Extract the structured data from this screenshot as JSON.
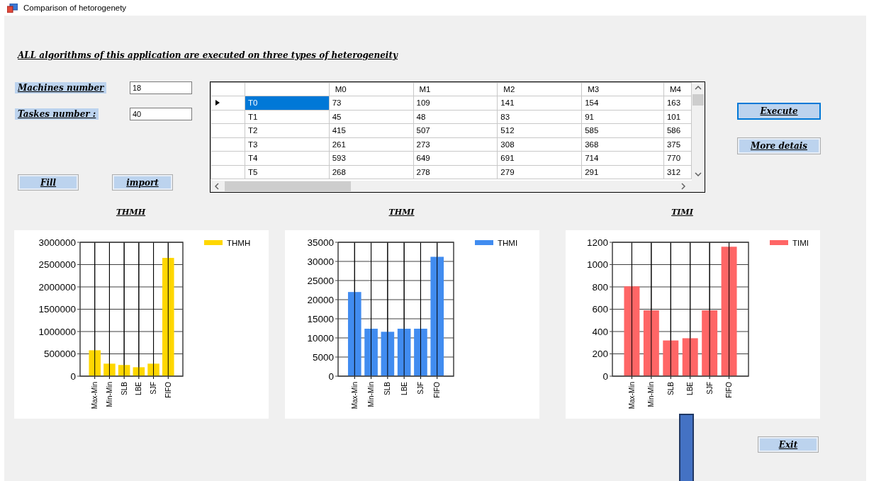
{
  "window": {
    "title": "Comparison of hetorogenety"
  },
  "heading": "ALL algorithms of this application are executed on three types of heterogeneity",
  "fields": [
    {
      "label": "Machines number",
      "value": "18"
    },
    {
      "label": "Taskes number :",
      "value": "40"
    }
  ],
  "left_buttons": [
    "Fill",
    "import"
  ],
  "grid": {
    "columns": [
      "M0",
      "M1",
      "M2",
      "M3",
      "M4"
    ],
    "rows": [
      {
        "header": "T0",
        "cells": [
          "73",
          "109",
          "141",
          "154",
          "163"
        ],
        "selected": true
      },
      {
        "header": "T1",
        "cells": [
          "45",
          "48",
          "83",
          "91",
          "101"
        ],
        "selected": false
      },
      {
        "header": "T2",
        "cells": [
          "415",
          "507",
          "512",
          "585",
          "586"
        ],
        "selected": false
      },
      {
        "header": "T3",
        "cells": [
          "261",
          "273",
          "308",
          "368",
          "375"
        ],
        "selected": false
      },
      {
        "header": "T4",
        "cells": [
          "593",
          "649",
          "691",
          "714",
          "770"
        ],
        "selected": false
      },
      {
        "header": "T5",
        "cells": [
          "268",
          "278",
          "279",
          "291",
          "312"
        ],
        "selected": false
      }
    ]
  },
  "right_buttons": [
    {
      "label": "Execute",
      "default": true
    },
    {
      "label": "More detais",
      "default": false
    }
  ],
  "charts": [
    {
      "heading": "THMH",
      "chart_data": {
        "type": "bar",
        "categories": [
          "Max-Min",
          "Min-Min",
          "SLB",
          "LBE",
          "SJF",
          "FIFO"
        ],
        "series": [
          {
            "name": "THMH",
            "color": "#ffd700",
            "values": [
              580000,
              280000,
              250000,
              200000,
              280000,
              2650000
            ]
          }
        ],
        "grid": true,
        "ylim": [
          0,
          3000000
        ],
        "yticks": [
          0,
          500000,
          1000000,
          1500000,
          2000000,
          2500000,
          3000000
        ]
      }
    },
    {
      "heading": "THMI",
      "chart_data": {
        "type": "bar",
        "categories": [
          "Max-Min",
          "Min-Min",
          "SLB",
          "LBE",
          "SJF",
          "FIFO"
        ],
        "series": [
          {
            "name": "THMI",
            "color": "#418cf0",
            "values": [
              22000,
              12400,
              11600,
              12400,
              12400,
              31200
            ]
          }
        ],
        "grid": true,
        "ylim": [
          0,
          35000
        ],
        "yticks": [
          0,
          5000,
          10000,
          15000,
          20000,
          25000,
          30000,
          35000
        ]
      }
    },
    {
      "heading": "TIMI",
      "chart_data": {
        "type": "bar",
        "categories": [
          "Max-Min",
          "Min-Min",
          "SLB",
          "LBE",
          "SJF",
          "FIFO"
        ],
        "series": [
          {
            "name": "TIMI",
            "color": "#ff6666",
            "values": [
              805,
              590,
              320,
              340,
              590,
              1160
            ]
          }
        ],
        "grid": true,
        "ylim": [
          0,
          1200
        ],
        "yticks": [
          0,
          200,
          400,
          600,
          800,
          1000,
          1200
        ]
      }
    }
  ],
  "exit_button": "Exit"
}
